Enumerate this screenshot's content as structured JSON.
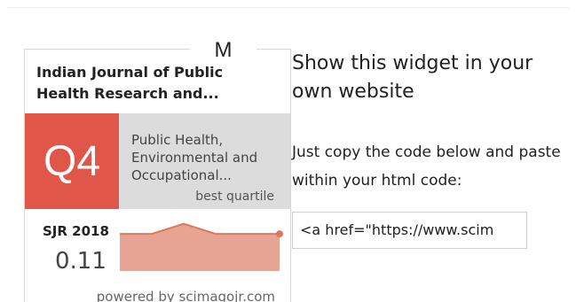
{
  "widget": {
    "journal_title": "Indian Journal of Public Health Research and...",
    "overlay_letter": "M",
    "quartile": "Q4",
    "subject_area": "Public Health, Environmental and Occupational...",
    "best_quartile_label": "best quartile",
    "sjr_label": "SJR 2018",
    "sjr_value": "0.11",
    "powered_by": "powered by scimagojr.com",
    "sjr_trend": [
      0.11,
      0.11,
      0.14,
      0.11,
      0.11,
      0.11
    ],
    "colors": {
      "quartile": "#e0574a",
      "trend": "#e8a492",
      "trend_line": "#e2765d"
    }
  },
  "panel": {
    "heading": "Show this widget in your own website",
    "instructions": "Just copy the code below and paste within your html code:",
    "embed_code": "<a href=\"https://www.scim"
  }
}
